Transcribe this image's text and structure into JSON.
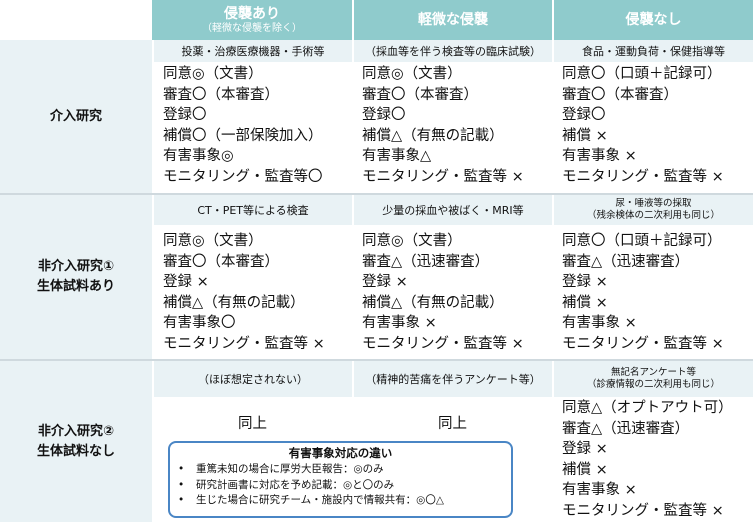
{
  "columns": [
    {
      "title": "侵襲あり",
      "sub": "（軽微な侵襲を除く）"
    },
    {
      "title": "軽微な侵襲",
      "sub": ""
    },
    {
      "title": "侵襲なし",
      "sub": ""
    }
  ],
  "rows": [
    {
      "label": [
        "介入研究"
      ],
      "examples": [
        [
          "投薬・治療医療機器・手術等"
        ],
        [
          "（採血等を伴う検査等の臨床試験）"
        ],
        [
          "食品・運動負荷・保健指導等"
        ]
      ],
      "cells": [
        [
          "同意◎（文書）",
          "審査〇（本審査）",
          "登録〇",
          "補償〇（一部保険加入）",
          "有害事象◎",
          "モニタリング・監査等〇"
        ],
        [
          "同意◎（文書）",
          "審査〇（本審査）",
          "登録〇",
          "補償△（有無の記載）",
          "有害事象△",
          "モニタリング・監査等 ×"
        ],
        [
          "同意〇（口頭＋記録可）",
          "審査〇（本審査）",
          "登録〇",
          "補償 ×",
          "有害事象 ×",
          "モニタリング・監査等 ×"
        ]
      ]
    },
    {
      "label": [
        "非介入研究①",
        "生体試料あり"
      ],
      "examples": [
        [
          "CT・PET等による検査"
        ],
        [
          "少量の採血や被ばく・MRI等"
        ],
        [
          "尿・唾液等の採取",
          "（残余検体の二次利用も同じ）"
        ]
      ],
      "cells": [
        [
          "同意◎（文書）",
          "審査〇（本審査）",
          "登録 ×",
          "補償△（有無の記載）",
          "有害事象〇",
          "モニタリング・監査等 ×"
        ],
        [
          "同意◎（文書）",
          "審査△（迅速審査）",
          "登録 ×",
          "補償△（有無の記載）",
          "有害事象 ×",
          "モニタリング・監査等 ×"
        ],
        [
          "同意〇（口頭＋記録可）",
          "審査△（迅速審査）",
          "登録 ×",
          "補償 ×",
          "有害事象 ×",
          "モニタリング・監査等 ×"
        ]
      ]
    },
    {
      "label": [
        "非介入研究②",
        "生体試料なし"
      ],
      "examples": [
        [
          "（ほぼ想定されない）"
        ],
        [
          "（精神的苦痛を伴うアンケート等）"
        ],
        [
          "無記名アンケート等",
          "（診療情報の二次利用も同じ）"
        ]
      ],
      "same_label": "同上",
      "cells_col3": [
        "同意△（オプトアウト可）",
        "審査△（迅速審査）",
        "登録 ×",
        "補償 ×",
        "有害事象 ×",
        "モニタリング・監査等 ×"
      ]
    }
  ],
  "note": {
    "title": "有害事象対応の違い",
    "bullet_char": "•",
    "items": [
      "重篤未知の場合に厚労大臣報告：◎のみ",
      "研究計画書に対応を予め記載：◎と〇のみ",
      "生じた場合に研究チーム・施設内で情報共有：◎〇△"
    ]
  },
  "colors": {
    "header_bg": "#8fcbcc",
    "label_bg": "#e9f2f5",
    "note_border": "#4a86c5"
  }
}
